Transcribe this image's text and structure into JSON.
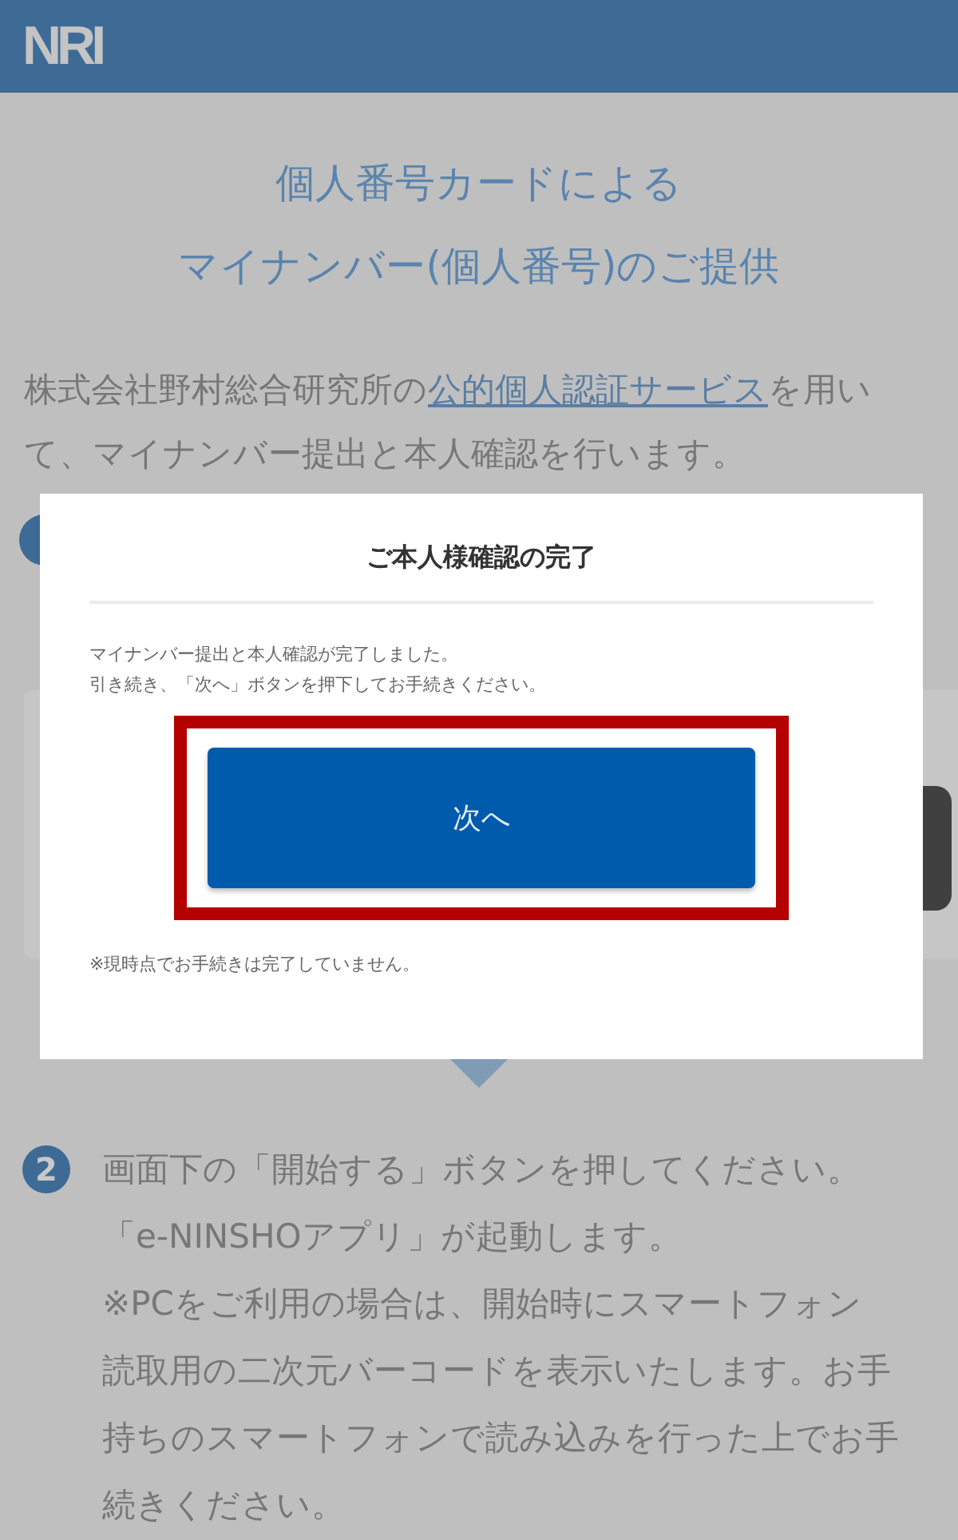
{
  "header": {
    "logo": "NRI"
  },
  "page": {
    "title_lines": [
      "個人番号カードによる",
      "マイナンバー(個人番号)のご提供"
    ],
    "intro": {
      "before": "株式会社野村総合研究所の",
      "link": "公的個人認証サービス",
      "after": "を用い",
      "line_2": "て、マイナンバー提出と本人確認を行います。"
    },
    "steps": [
      {
        "number": "2",
        "lines": [
          "画面下の「開始する」ボタンを押してください。",
          "「e-NINSHOアプリ」が起動します。",
          "※PCをご利用の場合は、開始時にスマートフォン",
          "読取用の二次元バーコードを表示いたします。お手",
          "持ちのスマートフォンで読み込みを行った上でお手",
          "続きください。"
        ]
      }
    ]
  },
  "dialog": {
    "title": "ご本人様確認の完了",
    "message_lines": [
      "マイナンバー提出と本人確認が完了しました。",
      "引き続き、「次へ」ボタンを押下してお手続きください。"
    ],
    "button": "次へ",
    "note": "※現時点でお手続きは完了していません。"
  }
}
